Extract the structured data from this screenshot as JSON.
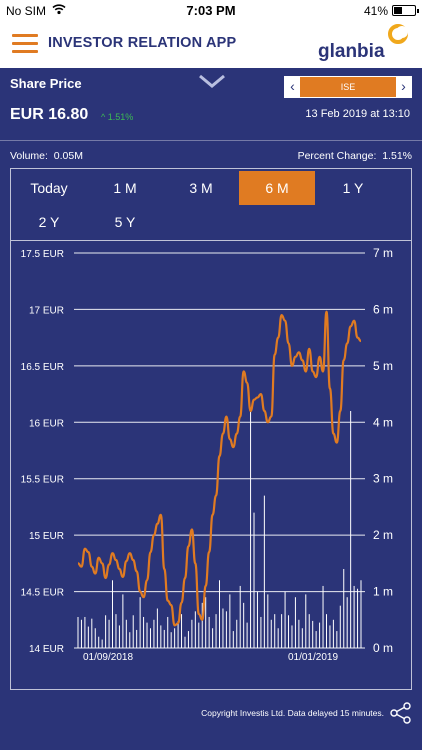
{
  "status_bar": {
    "carrier": "No SIM",
    "time": "7:03 PM",
    "battery": "41%",
    "battery_level": 0.41
  },
  "app_bar": {
    "title": "INVESTOR RELATION APP",
    "logo_text": "glanbia"
  },
  "share": {
    "section_title": "Share Price",
    "exchange": "ISE",
    "price": "EUR 16.80",
    "change": "^ 1.51%",
    "timestamp": "13 Feb 2019 at 13:10",
    "volume_label": "Volume:",
    "volume_value": "0.05M",
    "percent_label": "Percent Change:",
    "percent_value": "1.51%"
  },
  "range_tabs": [
    {
      "label": "Today",
      "active": false
    },
    {
      "label": "1 M",
      "active": false
    },
    {
      "label": "3 M",
      "active": false
    },
    {
      "label": "6 M",
      "active": true
    },
    {
      "label": "1 Y",
      "active": false
    },
    {
      "label": "2 Y",
      "active": false
    },
    {
      "label": "5 Y",
      "active": false
    }
  ],
  "colors": {
    "background": "#2b3478",
    "accent": "#e07b22",
    "positive": "#3cba54"
  },
  "chart_data": {
    "type": "line",
    "x_tick_labels": [
      "01/09/2018",
      "01/01/2019"
    ],
    "y_left": {
      "ticks": [
        "14 EUR",
        "14.5 EUR",
        "15 EUR",
        "15.5 EUR",
        "16 EUR",
        "16.5 EUR",
        "17 EUR",
        "17.5 EUR"
      ],
      "range": [
        14,
        17.5
      ]
    },
    "y_right": {
      "ticks": [
        "0 m",
        "1 m",
        "2 m",
        "3 m",
        "4 m",
        "5 m",
        "6 m",
        "7 m"
      ],
      "range": [
        0,
        7
      ]
    },
    "series": [
      {
        "kind": "line",
        "color": "#e07b22",
        "values": [
          14.75,
          14.72,
          14.88,
          14.85,
          14.72,
          14.66,
          14.8,
          14.75,
          14.62,
          14.74,
          14.84,
          14.78,
          14.7,
          14.63,
          14.77,
          14.84,
          14.78,
          14.68,
          14.5,
          14.45,
          14.6,
          14.85,
          15.0,
          15.1,
          15.18,
          14.7,
          14.42,
          14.38,
          14.2,
          14.22,
          14.4,
          14.62,
          14.9,
          15.05,
          14.75,
          14.3,
          14.25,
          14.55,
          14.85,
          15.18,
          15.35,
          15.7,
          15.9,
          16.05,
          15.85,
          15.78,
          15.9,
          16.05,
          16.45,
          16.35,
          16.1,
          16.2,
          16.22,
          16.25,
          16.1,
          16.0,
          16.05,
          16.6,
          16.75,
          16.95,
          16.9,
          16.7,
          16.5,
          16.58,
          16.62,
          16.55,
          16.45,
          16.65,
          16.45,
          16.4,
          16.58,
          16.45,
          16.98,
          16.3,
          15.9,
          15.82,
          16.1,
          16.55,
          16.7,
          16.85,
          16.9,
          16.75,
          16.72
        ]
      },
      {
        "kind": "bar",
        "color": "#ffffff",
        "axis": "right",
        "values": [
          0.55,
          0.5,
          0.55,
          0.38,
          0.52,
          0.35,
          0.2,
          0.15,
          0.58,
          0.5,
          1.2,
          0.6,
          0.4,
          0.95,
          0.5,
          0.28,
          0.58,
          0.32,
          0.9,
          0.55,
          0.45,
          0.35,
          0.5,
          0.7,
          0.4,
          0.32,
          0.55,
          0.28,
          0.35,
          0.48,
          0.6,
          0.2,
          0.3,
          0.5,
          0.65,
          0.45,
          0.8,
          0.9,
          0.55,
          0.35,
          0.6,
          1.2,
          0.7,
          0.65,
          0.95,
          0.3,
          0.5,
          1.1,
          0.8,
          0.45,
          4.2,
          2.4,
          1.0,
          0.55,
          2.7,
          0.95,
          0.5,
          0.6,
          0.35,
          0.6,
          1.0,
          0.58,
          0.4,
          0.9,
          0.5,
          0.35,
          0.95,
          0.6,
          0.48,
          0.3,
          0.45,
          1.1,
          0.6,
          0.4,
          0.5,
          0.3,
          0.75,
          1.4,
          0.9,
          4.2,
          1.1,
          1.05,
          1.2
        ]
      }
    ],
    "grid": true
  },
  "footer": {
    "copyright": "Copyright Investis Ltd. Data delayed 15 minutes."
  }
}
